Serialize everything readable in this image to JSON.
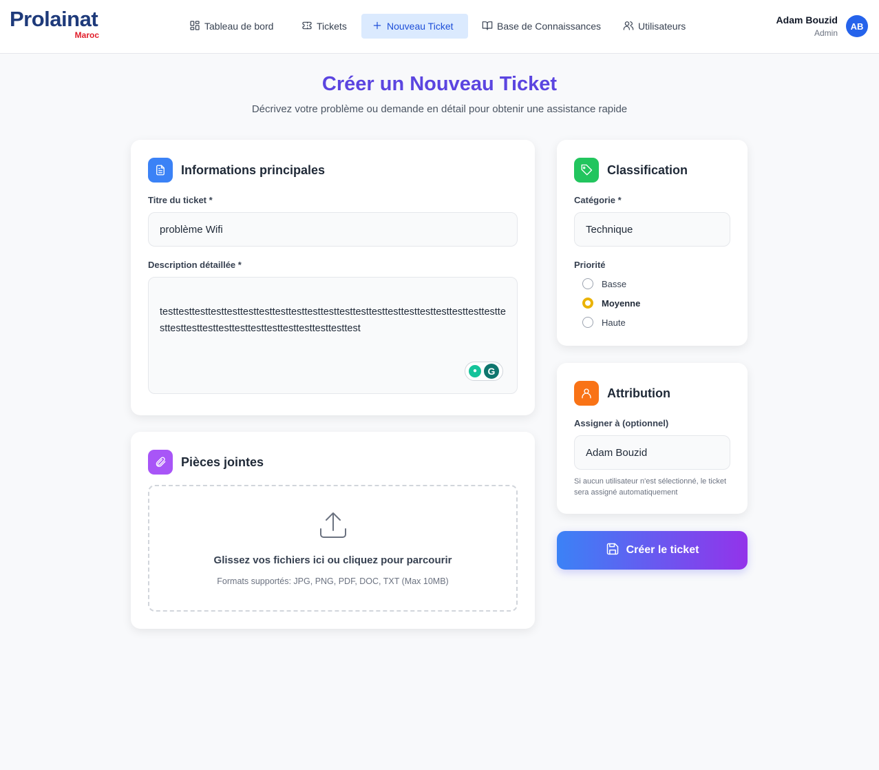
{
  "brand": {
    "name": "Prolainat",
    "sub": "Maroc"
  },
  "nav": [
    {
      "label": "Tableau de bord",
      "icon": "dashboard-icon"
    },
    {
      "label": "Tickets",
      "icon": "ticket-icon"
    },
    {
      "label": "Nouveau Ticket",
      "icon": "plus-icon",
      "active": true
    },
    {
      "label": "Base de Connaissances",
      "icon": "book-icon"
    },
    {
      "label": "Utilisateurs",
      "icon": "users-icon"
    }
  ],
  "user": {
    "name": "Adam Bouzid",
    "role": "Admin",
    "initials": "AB"
  },
  "page": {
    "title": "Créer un Nouveau Ticket",
    "subtitle": "Décrivez votre problème ou demande en détail pour obtenir une assistance rapide"
  },
  "main_info": {
    "title": "Informations principales",
    "title_label": "Titre du ticket *",
    "title_value": "problème Wifi",
    "desc_label": "Description détaillée *",
    "desc_value": "testtesttesttesttesttesttesttesttesttesttesttesttesttesttesttesttesttesttesttesttesttesttesttesttesttesttesttesttesttesttesttesttesttest"
  },
  "attachments": {
    "title": "Pièces jointes",
    "drop_title": "Glissez vos fichiers ici ou cliquez pour parcourir",
    "drop_sub": "Formats supportés: JPG, PNG, PDF, DOC, TXT (Max 10MB)"
  },
  "classification": {
    "title": "Classification",
    "category_label": "Catégorie *",
    "category_value": "Technique",
    "priority_label": "Priorité",
    "priorities": [
      "Basse",
      "Moyenne",
      "Haute"
    ],
    "selected_priority": "Moyenne"
  },
  "attribution": {
    "title": "Attribution",
    "assign_label": "Assigner à (optionnel)",
    "assign_value": "Adam Bouzid",
    "help": "Si aucun utilisateur n'est sélectionné, le ticket sera assigné automatiquement"
  },
  "submit_label": "Créer le ticket",
  "colors": {
    "accent": "#2563eb",
    "title_purple": "#5b45e0",
    "icon_blue": "#3b82f6",
    "icon_green": "#22c55e",
    "icon_orange": "#f97316",
    "icon_purple": "#a855f7",
    "radio_selected": "#eab308"
  }
}
